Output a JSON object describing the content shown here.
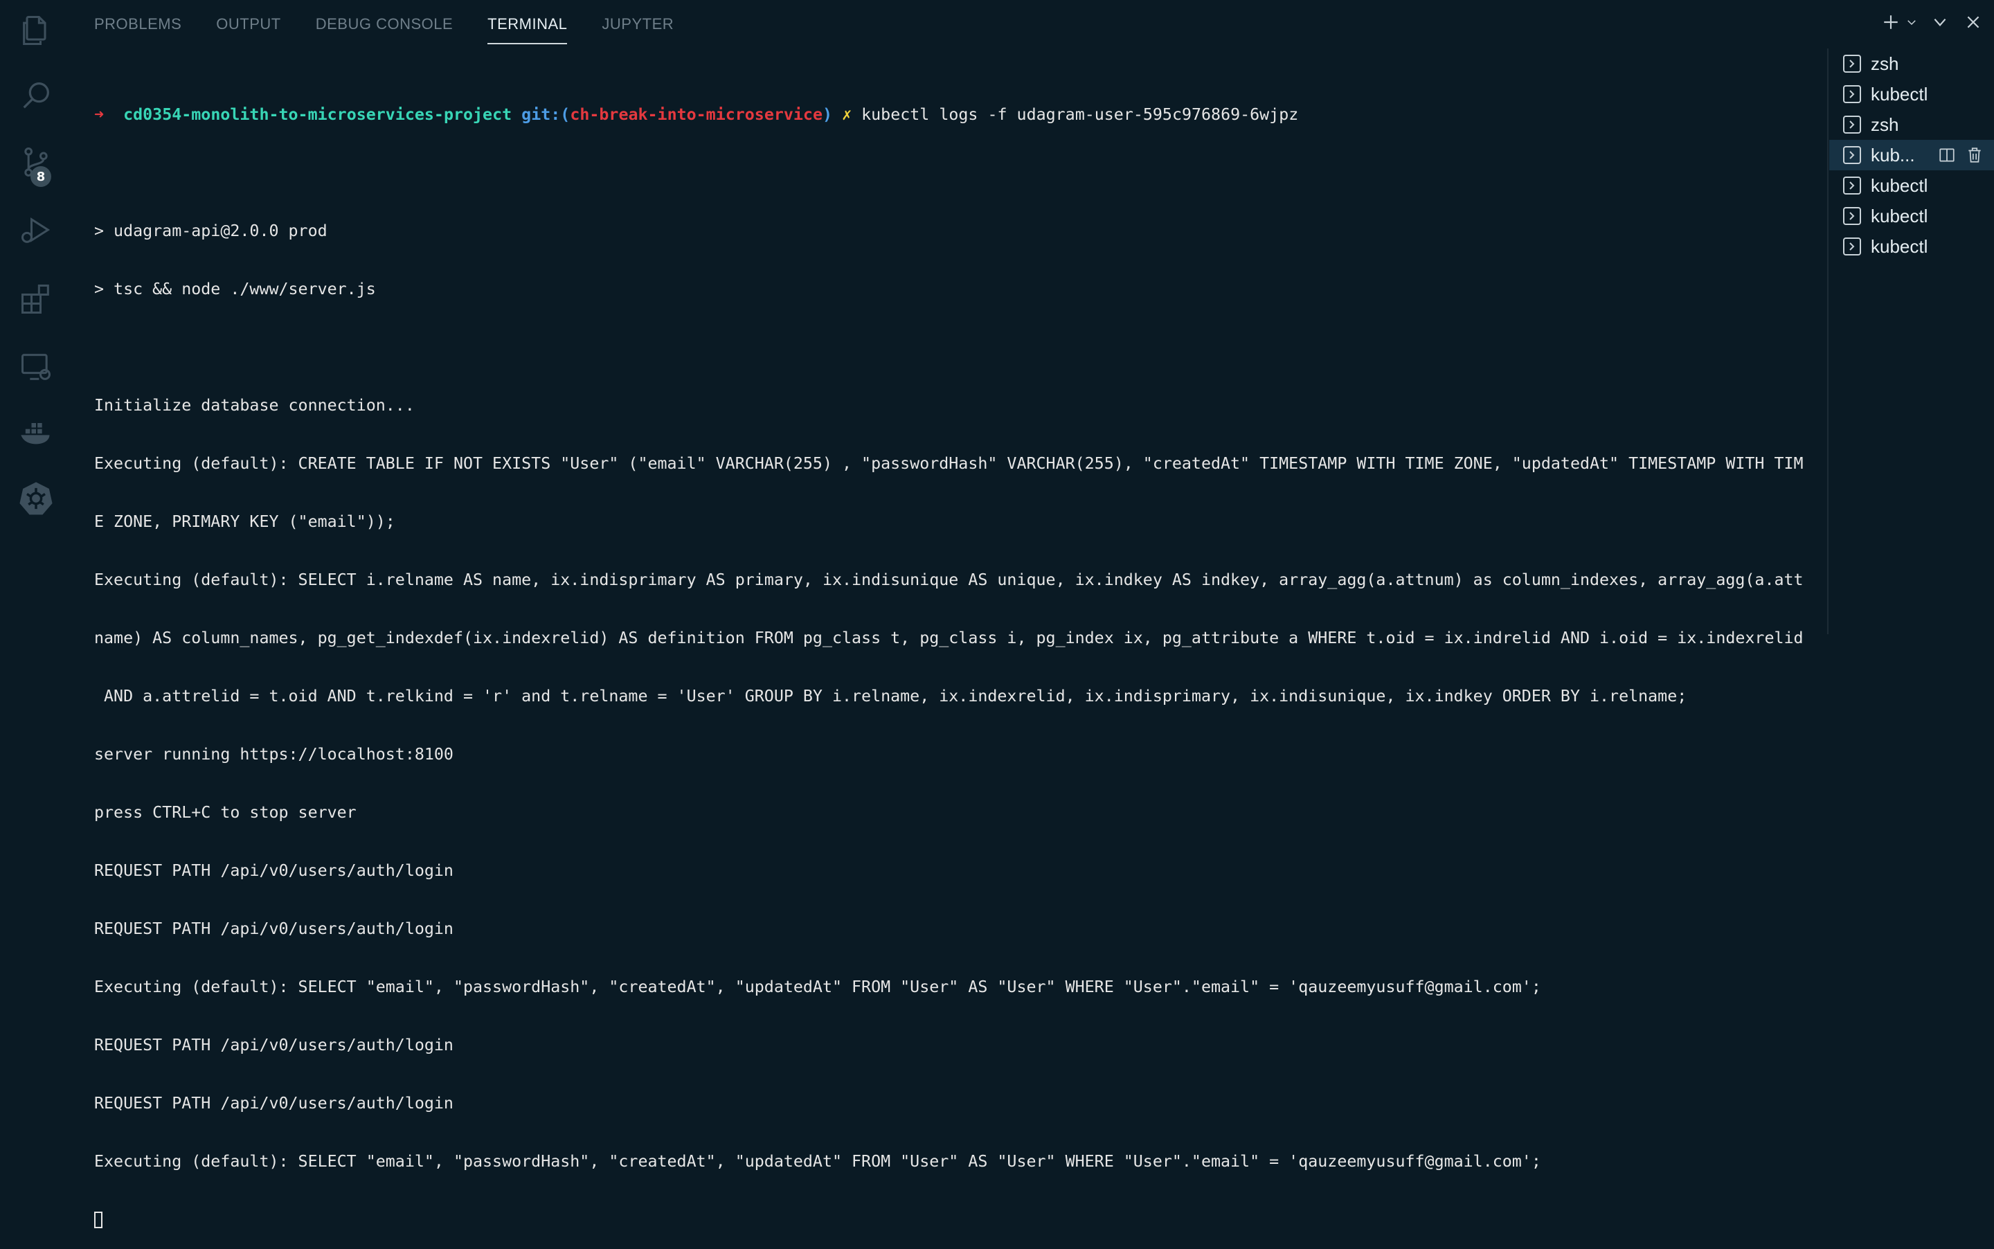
{
  "panel": {
    "tabs": [
      {
        "label": "PROBLEMS",
        "active": false
      },
      {
        "label": "OUTPUT",
        "active": false
      },
      {
        "label": "DEBUG CONSOLE",
        "active": false
      },
      {
        "label": "TERMINAL",
        "active": true
      },
      {
        "label": "JUPYTER",
        "active": false
      }
    ]
  },
  "activity_bar": {
    "icons": [
      "explorer-icon",
      "search-icon",
      "source-control-icon",
      "run-debug-icon",
      "extensions-icon",
      "remote-explorer-icon",
      "docker-icon",
      "kubernetes-icon"
    ],
    "source_control_badge": "8"
  },
  "toolbar": {
    "icons": [
      "plus-icon",
      "chevron-down-icon",
      "chevron-down-icon",
      "close-icon"
    ]
  },
  "terminal": {
    "prompt": {
      "arrow": "➜",
      "directory": "cd0354-monolith-to-microservices-project",
      "git_label": "git:(",
      "branch": "ch-break-into-microservice",
      "git_close": ")",
      "dirty_mark": "✗",
      "command": "kubectl logs -f udagram-user-595c976869-6wjpz"
    },
    "lines": [
      "",
      "> udagram-api@2.0.0 prod",
      "> tsc && node ./www/server.js",
      "",
      "Initialize database connection...",
      "Executing (default): CREATE TABLE IF NOT EXISTS \"User\" (\"email\" VARCHAR(255) , \"passwordHash\" VARCHAR(255), \"createdAt\" TIMESTAMP WITH TIME ZONE, \"updatedAt\" TIMESTAMP WITH TIM",
      "E ZONE, PRIMARY KEY (\"email\"));",
      "Executing (default): SELECT i.relname AS name, ix.indisprimary AS primary, ix.indisunique AS unique, ix.indkey AS indkey, array_agg(a.attnum) as column_indexes, array_agg(a.att",
      "name) AS column_names, pg_get_indexdef(ix.indexrelid) AS definition FROM pg_class t, pg_class i, pg_index ix, pg_attribute a WHERE t.oid = ix.indrelid AND i.oid = ix.indexrelid",
      " AND a.attrelid = t.oid AND t.relkind = 'r' and t.relname = 'User' GROUP BY i.relname, ix.indexrelid, ix.indisprimary, ix.indisunique, ix.indkey ORDER BY i.relname;",
      "server running https://localhost:8100",
      "press CTRL+C to stop server",
      "REQUEST PATH /api/v0/users/auth/login",
      "REQUEST PATH /api/v0/users/auth/login",
      "Executing (default): SELECT \"email\", \"passwordHash\", \"createdAt\", \"updatedAt\" FROM \"User\" AS \"User\" WHERE \"User\".\"email\" = 'qauzeemyusuff@gmail.com';",
      "REQUEST PATH /api/v0/users/auth/login",
      "REQUEST PATH /api/v0/users/auth/login",
      "Executing (default): SELECT \"email\", \"passwordHash\", \"createdAt\", \"updatedAt\" FROM \"User\" AS \"User\" WHERE \"User\".\"email\" = 'qauzeemyusuff@gmail.com';"
    ]
  },
  "terminal_list": {
    "items": [
      {
        "label": "zsh",
        "active": false
      },
      {
        "label": "kubectl",
        "active": false
      },
      {
        "label": "zsh",
        "active": false
      },
      {
        "label": "kub...",
        "active": true
      },
      {
        "label": "kubectl",
        "active": false
      },
      {
        "label": "kubectl",
        "active": false
      },
      {
        "label": "kubectl",
        "active": false
      }
    ],
    "active_actions": [
      "split-icon",
      "trash-icon"
    ]
  },
  "colors": {
    "background": "#0a1a24",
    "prompt_arrow": "#e5393f",
    "directory": "#38d6b6",
    "git": "#4d9de6",
    "branch": "#e5393f",
    "dirty": "#f1d33c"
  }
}
